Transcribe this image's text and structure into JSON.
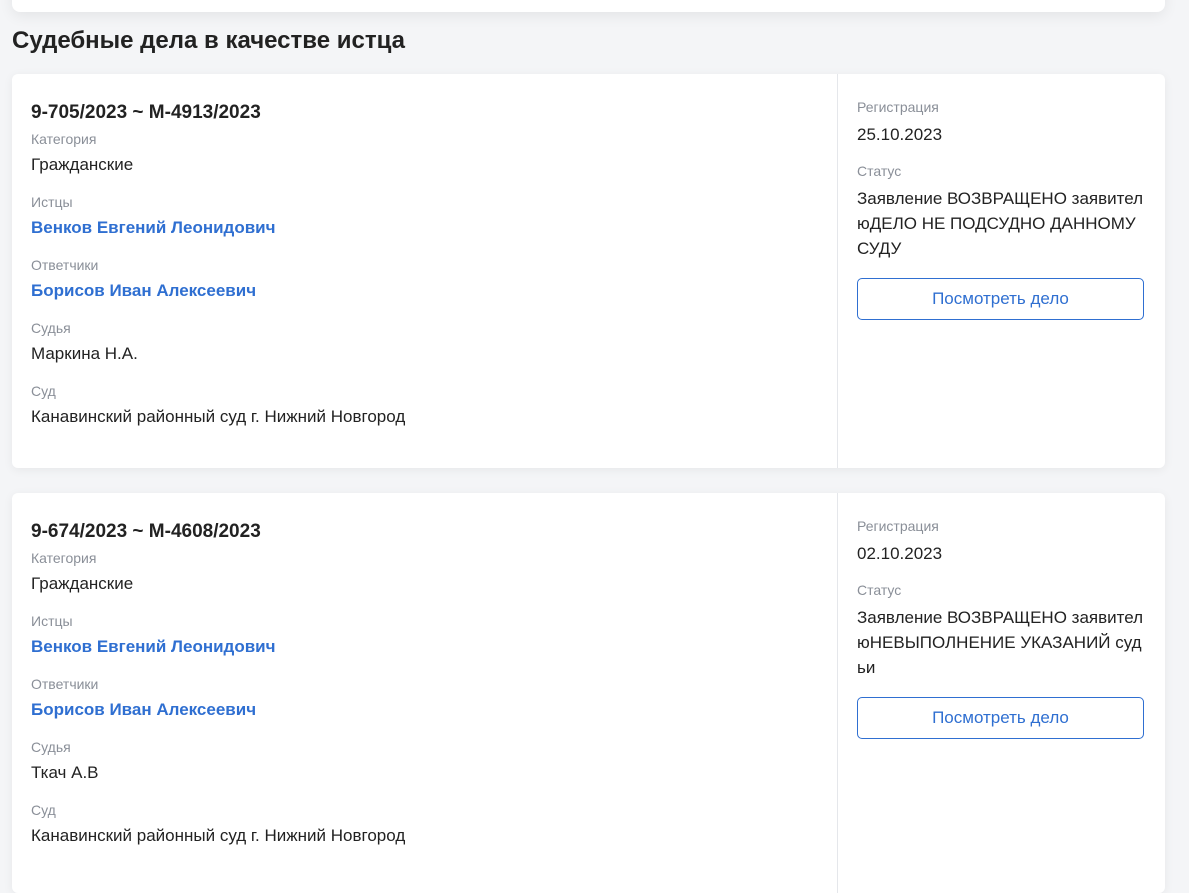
{
  "page": {
    "title": "Судебные дела в качестве истца"
  },
  "labels": {
    "category": "Категория",
    "plaintiffs": "Истцы",
    "defendants": "Ответчики",
    "judge": "Судья",
    "court": "Суд",
    "registration": "Регистрация",
    "status": "Статус",
    "view_button": "Посмотреть дело"
  },
  "cases": [
    {
      "number": "9-705/2023 ~ М-4913/2023",
      "category": "Гражданские",
      "plaintiffs": "Венков Евгений Леонидович",
      "defendants": "Борисов Иван Алексеевич",
      "judge": "Маркина Н.А.",
      "court": "Канавинский районный суд г. Нижний Новгород",
      "registration": "25.10.2023",
      "status": "Заявление ВОЗВРАЩЕНО заявителюДЕЛО НЕ ПОДСУДНО ДАННОМУ СУДУ"
    },
    {
      "number": "9-674/2023 ~ М-4608/2023",
      "category": "Гражданские",
      "plaintiffs": "Венков Евгений Леонидович",
      "defendants": "Борисов Иван Алексеевич",
      "judge": "Ткач А.В",
      "court": "Канавинский районный суд г. Нижний Новгород",
      "registration": "02.10.2023",
      "status": "Заявление ВОЗВРАЩЕНО заявителюНЕВЫПОЛНЕНИЕ УКАЗАНИЙ судьи"
    }
  ]
}
